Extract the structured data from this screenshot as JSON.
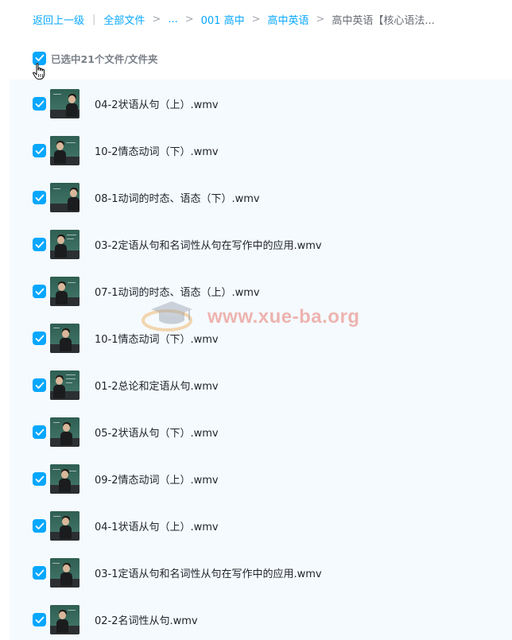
{
  "breadcrumb": {
    "back": "返回上一级",
    "all_files": "全部文件",
    "ellipsis": "...",
    "level1": "001 高中",
    "level2": "高中英语",
    "current": "高中英语【核心语法..."
  },
  "selection": {
    "label": "已选中21个文件/文件夹",
    "checked": true
  },
  "watermark": {
    "text": "www.xue-ba.org"
  },
  "files": [
    {
      "name": "04-2状语从句（上）.wmv",
      "checked": true
    },
    {
      "name": "10-2情态动词（下）.wmv",
      "checked": true
    },
    {
      "name": "08-1动词的时态、语态（下）.wmv",
      "checked": true
    },
    {
      "name": "03-2定语从句和名词性从句在写作中的应用.wmv",
      "checked": true
    },
    {
      "name": "07-1动词的时态、语态（上）.wmv",
      "checked": true
    },
    {
      "name": "10-1情态动词（下）.wmv",
      "checked": true
    },
    {
      "name": "01-2总论和定语从句.wmv",
      "checked": true
    },
    {
      "name": "05-2状语从句（下）.wmv",
      "checked": true
    },
    {
      "name": "09-2情态动词（上）.wmv",
      "checked": true
    },
    {
      "name": "04-1状语从句（上）.wmv",
      "checked": true
    },
    {
      "name": "03-1定语从句和名词性从句在写作中的应用.wmv",
      "checked": true
    },
    {
      "name": "02-2名词性从句.wmv",
      "checked": true
    }
  ],
  "colors": {
    "accent": "#06a7ff",
    "row_bg": "#f5fafe",
    "watermark": "#e7786e"
  }
}
